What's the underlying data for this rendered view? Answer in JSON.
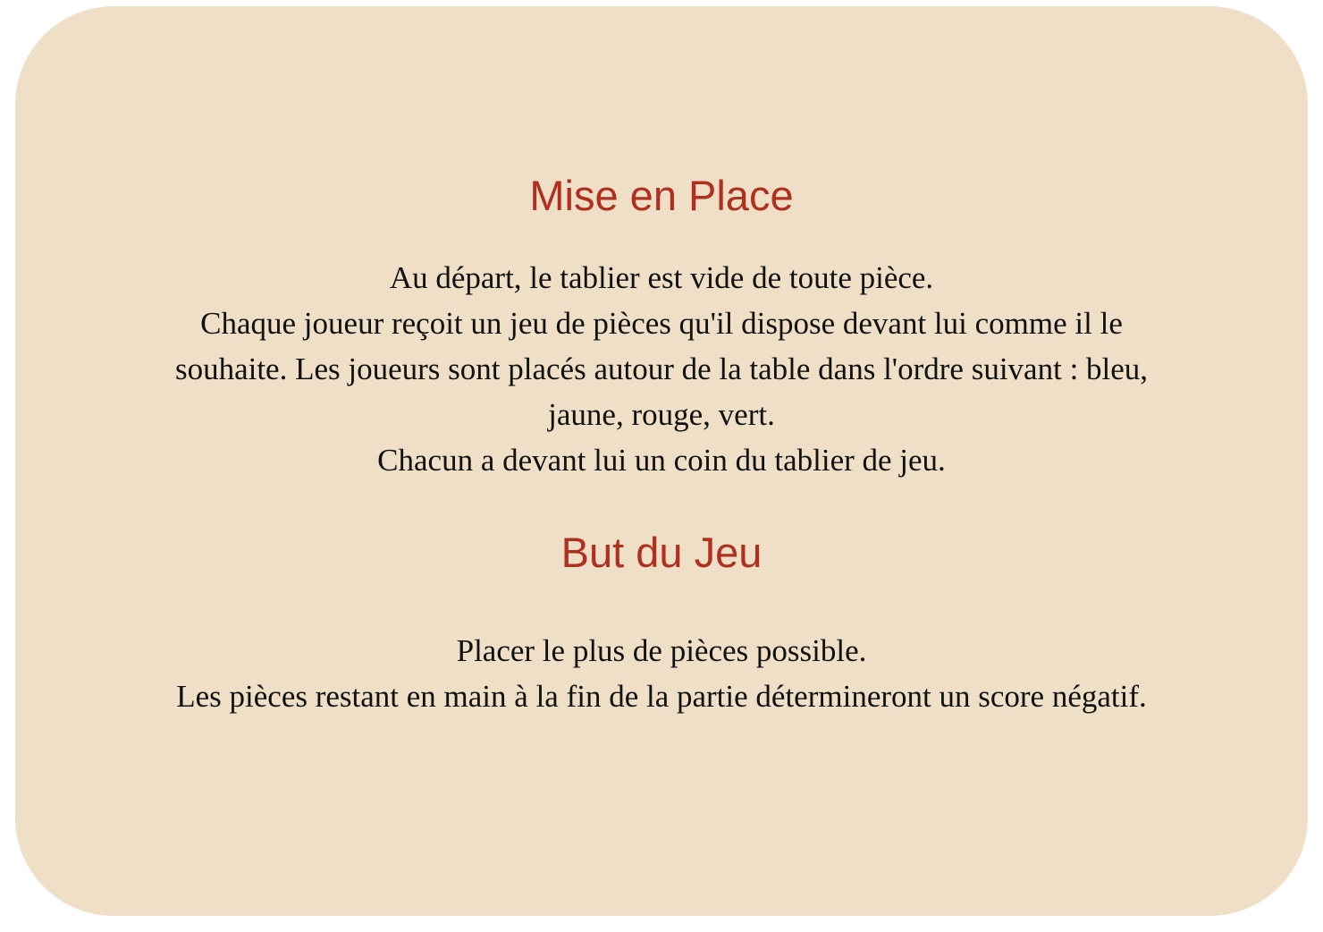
{
  "sections": [
    {
      "title": "Mise en Place",
      "lines": [
        "Au départ, le tablier est vide de toute pièce.",
        "Chaque joueur reçoit un jeu de pièces qu'il dispose devant lui comme il le",
        "souhaite. Les joueurs sont placés autour de la table dans l'ordre suivant : bleu,",
        "jaune, rouge, vert.",
        "Chacun a devant lui un coin du tablier de jeu."
      ]
    },
    {
      "title": "But du Jeu",
      "lines": [
        "Placer le plus de pièces possible.",
        "Les pièces restant en main à la fin de la partie détermineront un score négatif."
      ]
    }
  ],
  "colors": {
    "card_background": "#EEDFC6",
    "heading": "#B0301F"
  }
}
